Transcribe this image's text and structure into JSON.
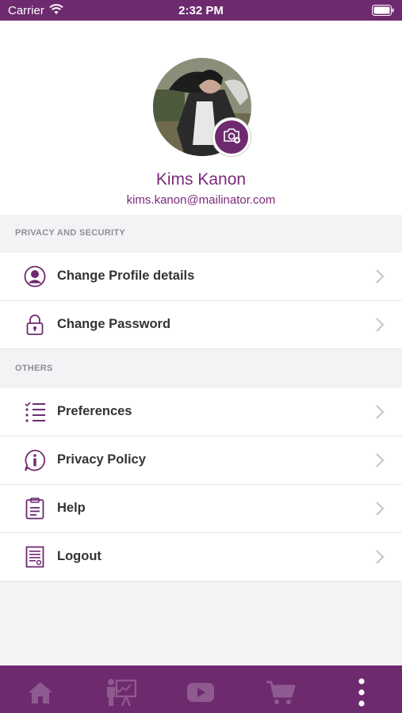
{
  "status_bar": {
    "carrier": "Carrier",
    "time": "2:32 PM"
  },
  "profile": {
    "name": "Kims Kanon",
    "email": "kims.kanon@mailinator.com"
  },
  "sections": [
    {
      "header": "PRIVACY AND SECURITY",
      "items": [
        {
          "label": "Change Profile details",
          "icon": "user-circle-icon"
        },
        {
          "label": "Change Password",
          "icon": "lock-icon"
        }
      ]
    },
    {
      "header": "OTHERS",
      "items": [
        {
          "label": "Preferences",
          "icon": "checklist-icon"
        },
        {
          "label": "Privacy Policy",
          "icon": "info-icon"
        },
        {
          "label": "Help",
          "icon": "clipboard-icon"
        },
        {
          "label": "Logout",
          "icon": "document-icon"
        }
      ]
    }
  ],
  "tab_bar": {
    "tabs": [
      "home-icon",
      "presentation-icon",
      "video-icon",
      "cart-icon",
      "more-icon"
    ]
  },
  "colors": {
    "primary": "#6e2a6f",
    "accent_text": "#7a2a7b",
    "background": "#f3f3f5"
  }
}
